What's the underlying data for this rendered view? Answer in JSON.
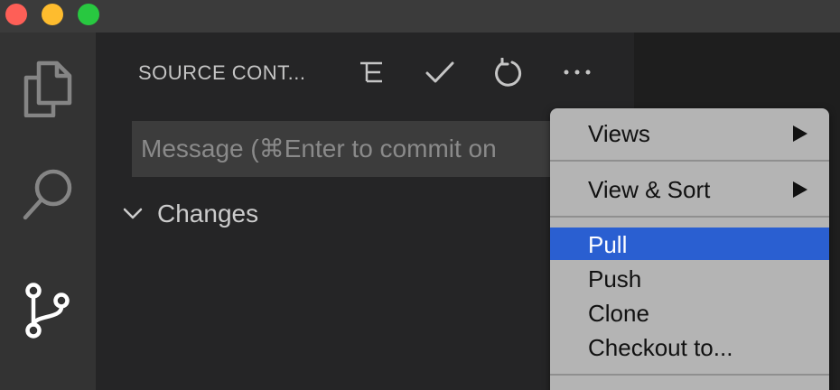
{
  "window": {
    "controls": [
      "close",
      "minimize",
      "maximize"
    ],
    "colors": {
      "close": "#fe5f57",
      "minimize": "#febc2e",
      "maximize": "#28c840"
    }
  },
  "activity_bar": {
    "items": [
      {
        "icon": "files-icon",
        "active": false
      },
      {
        "icon": "search-icon",
        "active": false
      },
      {
        "icon": "source-control-icon",
        "active": true
      }
    ]
  },
  "sidebar": {
    "title": "SOURCE CONT...",
    "actions": [
      "tree-view-icon",
      "check-icon",
      "refresh-icon",
      "more-icon"
    ],
    "commit_message": {
      "value": "",
      "placeholder": "Message (⌘Enter to commit on"
    },
    "changes_label": "Changes"
  },
  "menu": {
    "items": [
      {
        "label": "Views",
        "submenu": true
      },
      {
        "label": "View & Sort",
        "submenu": true
      },
      {
        "label": "Pull",
        "highlighted": true
      },
      {
        "label": "Push"
      },
      {
        "label": "Clone"
      },
      {
        "label": "Checkout to..."
      }
    ],
    "highlight_color": "#2a5fd1",
    "arrow_glyph": "▶"
  }
}
